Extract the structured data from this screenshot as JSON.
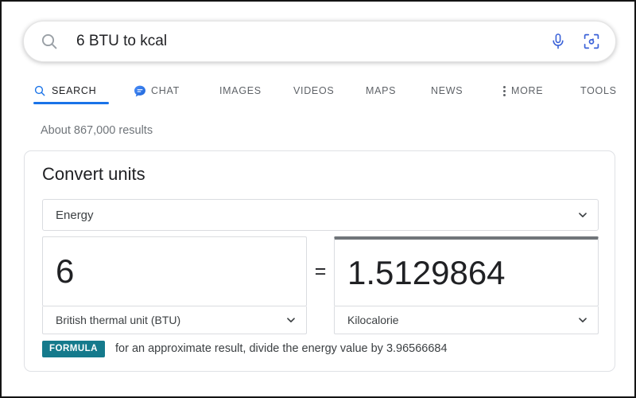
{
  "search": {
    "query": "6 BTU to kcal",
    "placeholder": "Search",
    "search_icon": "search-icon",
    "mic_icon": "microphone-icon",
    "lens_icon": "google-lens-icon"
  },
  "tabs": [
    {
      "label": "SEARCH",
      "icon": "search-icon",
      "active": true
    },
    {
      "label": "CHAT",
      "icon": "chat-bubble-icon",
      "active": false
    },
    {
      "label": "IMAGES",
      "icon": "",
      "active": false
    },
    {
      "label": "VIDEOS",
      "icon": "",
      "active": false
    },
    {
      "label": "MAPS",
      "icon": "",
      "active": false
    },
    {
      "label": "NEWS",
      "icon": "",
      "active": false
    },
    {
      "label": "MORE",
      "icon": "overflow-dots-icon",
      "active": false
    },
    {
      "label": "TOOLS",
      "icon": "",
      "active": false
    }
  ],
  "results": {
    "count_text": "About 867,000 results"
  },
  "converter": {
    "title": "Convert units",
    "category": "Energy",
    "category_chevron": "chevron-down-icon",
    "from": {
      "value": "6",
      "unit": "British thermal unit (BTU)",
      "chevron": "chevron-down-icon"
    },
    "equals": "=",
    "to": {
      "value": "1.5129864",
      "unit": "Kilocalorie",
      "chevron": "chevron-down-icon"
    },
    "formula_badge": "FORMULA",
    "formula_text": "for an approximate result, divide the energy value by 3.96566684"
  },
  "colors": {
    "accent_blue": "#1a73e8",
    "formula_teal": "#157a8c",
    "text_primary": "#202124",
    "text_secondary": "#70757a",
    "border": "#dadce0"
  }
}
